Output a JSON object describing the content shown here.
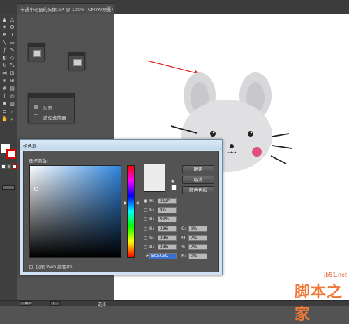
{
  "document_tab": {
    "title": "卡通小老鼠的头像.ai* @ 100% (CMYK/预览)",
    "close": "×"
  },
  "panels": {
    "align_panel": {
      "items": [
        {
          "label": "对齐"
        },
        {
          "label": "路径查找器"
        }
      ]
    }
  },
  "color_picker": {
    "title": "拾色器",
    "select_label": "选择颜色:",
    "buttons": {
      "ok": "确定",
      "cancel": "取消",
      "swatches": "颜色色板"
    },
    "hsb": [
      {
        "label": "H:",
        "value": "213°",
        "selected": true
      },
      {
        "label": "S:",
        "value": "8%",
        "selected": false
      },
      {
        "label": "B:",
        "value": "92%",
        "selected": false
      }
    ],
    "rgb": [
      {
        "label": "R:",
        "value": "236"
      },
      {
        "label": "G:",
        "value": "236"
      },
      {
        "label": "B:",
        "value": "236"
      }
    ],
    "cmyk": [
      {
        "label": "C:",
        "value": "9%"
      },
      {
        "label": "M:",
        "value": "7%"
      },
      {
        "label": "Y:",
        "value": "7%"
      },
      {
        "label": "K:",
        "value": "0%"
      }
    ],
    "hex": {
      "label": "#",
      "value": "ECECEC"
    },
    "web_only": "仅限 Web 颜色(O)",
    "current_color": "#ececec"
  },
  "statusbar": {
    "zoom": "100%",
    "page": "1",
    "status": "选择"
  },
  "watermark": {
    "url": "jb51.net",
    "name": "脚本之家"
  },
  "colors": {
    "arrow": "#e02020",
    "mouse_ear": "#d8d8da",
    "mouse_inner_ear": "#c8c8cc",
    "cheek": "#e0507a"
  }
}
